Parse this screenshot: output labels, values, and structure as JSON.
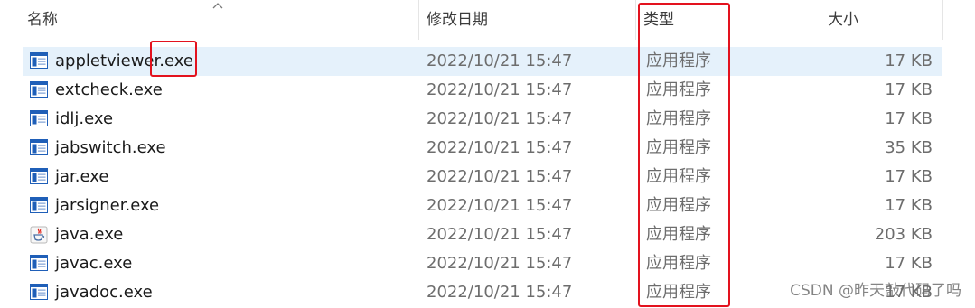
{
  "columns": {
    "name": "名称",
    "date": "修改日期",
    "type": "类型",
    "size": "大小"
  },
  "files": [
    {
      "name": "appletviewer.exe",
      "date": "2022/10/21 15:47",
      "type": "应用程序",
      "size": "17 KB",
      "icon": "application-icon"
    },
    {
      "name": "extcheck.exe",
      "date": "2022/10/21 15:47",
      "type": "应用程序",
      "size": "17 KB",
      "icon": "application-icon"
    },
    {
      "name": "idlj.exe",
      "date": "2022/10/21 15:47",
      "type": "应用程序",
      "size": "17 KB",
      "icon": "application-icon"
    },
    {
      "name": "jabswitch.exe",
      "date": "2022/10/21 15:47",
      "type": "应用程序",
      "size": "35 KB",
      "icon": "application-icon"
    },
    {
      "name": "jar.exe",
      "date": "2022/10/21 15:47",
      "type": "应用程序",
      "size": "17 KB",
      "icon": "application-icon"
    },
    {
      "name": "jarsigner.exe",
      "date": "2022/10/21 15:47",
      "type": "应用程序",
      "size": "17 KB",
      "icon": "application-icon"
    },
    {
      "name": "java.exe",
      "date": "2022/10/21 15:47",
      "type": "应用程序",
      "size": "203 KB",
      "icon": "java-cup-icon"
    },
    {
      "name": "javac.exe",
      "date": "2022/10/21 15:47",
      "type": "应用程序",
      "size": "17 KB",
      "icon": "application-icon"
    },
    {
      "name": "javadoc.exe",
      "date": "2022/10/21 15:47",
      "type": "应用程序",
      "size": "17 KB",
      "icon": "application-icon"
    }
  ],
  "selected_row": 0,
  "watermark": "CSDN @昨天敲代码了吗",
  "colors": {
    "selection": "#e5f1fb",
    "highlight_box": "#e3121e",
    "header_text": "#3c3c3c",
    "secondary_text": "#6d6d6d",
    "icon_blue": "#1f5fb8"
  }
}
